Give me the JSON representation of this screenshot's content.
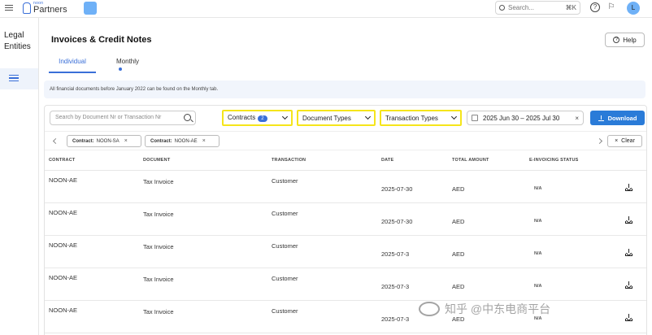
{
  "topbar": {
    "logo_small": "noon",
    "logo_main": "Partners",
    "search_placeholder": "Search...",
    "search_shortcut": "⌘K",
    "avatar_initial": "L"
  },
  "sidebar": {
    "title_line1": "Legal",
    "title_line2": "Entities"
  },
  "page": {
    "title": "Invoices & Credit Notes",
    "help_label": "Help",
    "tabs": [
      {
        "label": "Individual",
        "active": true
      },
      {
        "label": "Monthly",
        "active": false
      }
    ],
    "info_text": "All financial documents before January 2022 can be found on the Monthly tab."
  },
  "filters": {
    "search_placeholder": "Search by Document Nr or Transaction Nr",
    "contracts_label": "Contracts",
    "contracts_count": "2",
    "document_types_label": "Document Types",
    "transaction_types_label": "Transaction Types",
    "date_range": "2025 Jun 30 – 2025 Jul 30",
    "download_label": "Download",
    "clear_label": "Clear",
    "chips": [
      {
        "key": "Contract:",
        "value": "NOON-SA"
      },
      {
        "key": "Contract:",
        "value": "NOON-AE"
      }
    ]
  },
  "table": {
    "headers": [
      "CONTRACT",
      "DOCUMENT",
      "TRANSACTION",
      "DATE",
      "TOTAL AMOUNT",
      "E-INVOICING STATUS"
    ],
    "rows": [
      {
        "contract": "NOON-AE",
        "document": "Tax Invoice",
        "transaction": "Customer",
        "date": "2025-07-30",
        "amount": "AED",
        "status": "N/A"
      },
      {
        "contract": "NOON-AE",
        "document": "Tax Invoice",
        "transaction": "Customer",
        "date": "2025-07-30",
        "amount": "AED",
        "status": "N/A"
      },
      {
        "contract": "NOON-AE",
        "document": "Tax Invoice",
        "transaction": "Customer",
        "date": "2025-07-3",
        "amount": "AED",
        "status": "N/A"
      },
      {
        "contract": "NOON-AE",
        "document": "Tax Invoice",
        "transaction": "Customer",
        "date": "2025-07-3",
        "amount": "AED",
        "status": "N/A"
      },
      {
        "contract": "NOON-AE",
        "document": "Tax Invoice",
        "transaction": "Customer",
        "date": "2025-07-3",
        "amount": "AED",
        "status": "N/A"
      }
    ]
  },
  "watermark": "知乎 @中东电商平台",
  "colors": {
    "accent": "#3a6fd8",
    "highlight": "#f5e51b",
    "download": "#2a7bd8"
  }
}
